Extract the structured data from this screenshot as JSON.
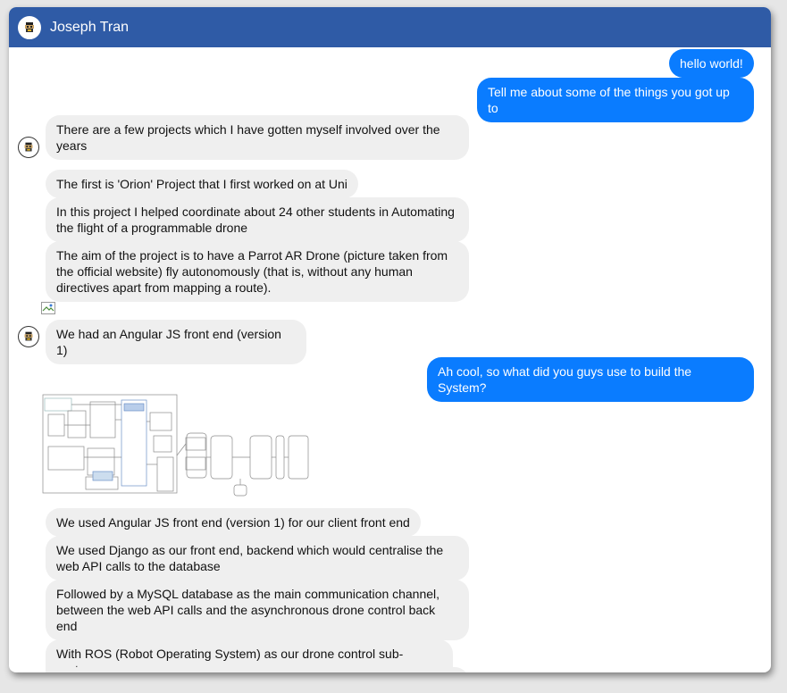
{
  "contact": {
    "name": "Joseph Tran"
  },
  "messages": [
    {
      "from": "me",
      "text": "hello world!"
    },
    {
      "from": "me",
      "text": "Tell me about some of the things you got up to"
    },
    {
      "from": "them",
      "text": "There are a few projects which I have gotten myself involved over the years"
    },
    {
      "from": "them",
      "text": "The first is 'Orion' Project that I first worked on at Uni"
    },
    {
      "from": "them",
      "text": "In this project I helped coordinate about 24 other students in Automating the flight of a programmable drone"
    },
    {
      "from": "them",
      "text": "The aim of the project is to have a Parrot AR Drone (picture taken from the official website) fly autonomously (that is, without any human directives apart from mapping a route)."
    },
    {
      "from": "them",
      "text": "We had an Angular JS front end (version 1)"
    },
    {
      "from": "me",
      "text": "Ah cool, so what did you guys use to build the System?"
    },
    {
      "from": "them",
      "text": "We used Angular JS front end (version 1) for our client front end"
    },
    {
      "from": "them",
      "text": "We used Django as our front end, backend which would centralise the web API calls to the database"
    },
    {
      "from": "them",
      "text": "Followed by a MySQL database as the main communication channel, between the web API calls and the asynchronous drone control back end"
    },
    {
      "from": "them",
      "text": "With ROS (Robot Operating System) as our drone control sub-system"
    }
  ],
  "colors": {
    "header": "#2f5ba6",
    "outgoing": "#0a7cff",
    "incoming": "#efefef"
  }
}
